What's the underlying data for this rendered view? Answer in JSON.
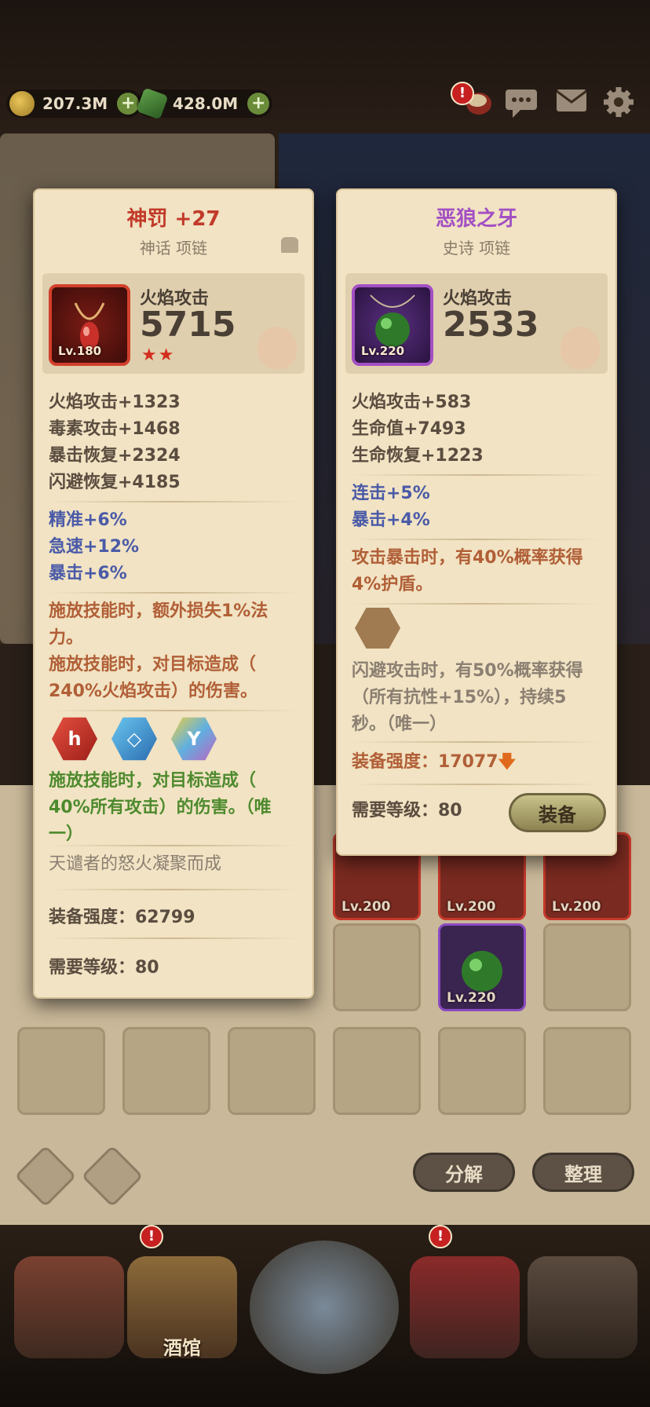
{
  "currency": {
    "gold": "207.3M",
    "gems": "428.0M"
  },
  "colors": {
    "epic_purple": "#a34fc4",
    "myth_red": "#c23a2a",
    "set_orange": "#b15f37",
    "gem_green": "#4e8a2e",
    "stat_blue": "#4a5aa8"
  },
  "icons": [
    "coin-icon",
    "gem-icon",
    "plus-icon",
    "chat-icon",
    "mail-icon",
    "gear-icon",
    "alert-badge-icon",
    "scroll-icon",
    "flame-icon",
    "arrow-down-icon"
  ],
  "item_left": {
    "name": "神罚 +27",
    "type": "神话 项链",
    "main_stat_label": "火焰攻击",
    "main_stat_value": "5715",
    "level": "Lv.180",
    "stars": "★★",
    "stats": [
      "火焰攻击+1323",
      "毒素攻击+1468",
      "暴击恢复+2324",
      "闪避恢复+4185"
    ],
    "bonus": [
      "精准+6%",
      "急速+12%",
      "暴击+6%"
    ],
    "effects": [
      "施放技能时，额外损失1%法",
      "力。",
      "施放技能时，对目标造成（",
      "240%火焰攻击）的伤害。"
    ],
    "gem_effect": [
      "施放技能时，对目标造成（",
      "40%所有攻击）的伤害。（唯",
      "一）"
    ],
    "flavor": "天谴者的怒火凝聚而成",
    "strength": "装备强度：62799",
    "required_level": "需要等级：80"
  },
  "item_right": {
    "name": "恶狼之牙",
    "type": "史诗 项链",
    "main_stat_label": "火焰攻击",
    "main_stat_value": "2533",
    "level": "Lv.220",
    "stats": [
      "火焰攻击+583",
      "生命值+7493",
      "生命恢复+1223"
    ],
    "bonus": [
      "连击+5%",
      "暴击+4%"
    ],
    "effects": [
      "攻击暴击时，有40%概率获得",
      "4%护盾。"
    ],
    "slot_effect": [
      "闪避攻击时，有50%概率获得",
      "（所有抗性+15%），持续5",
      "秒。（唯一）"
    ],
    "strength": "装备强度：17077",
    "required_level": "需要等级：80",
    "equip_button": "装备"
  },
  "inventory": {
    "levels": [
      "Lv.200",
      "Lv.200",
      "Lv.200",
      "Lv.220"
    ]
  },
  "actions": {
    "decompose": "分解",
    "sort": "整理"
  },
  "nav": {
    "tavern": "酒馆"
  }
}
